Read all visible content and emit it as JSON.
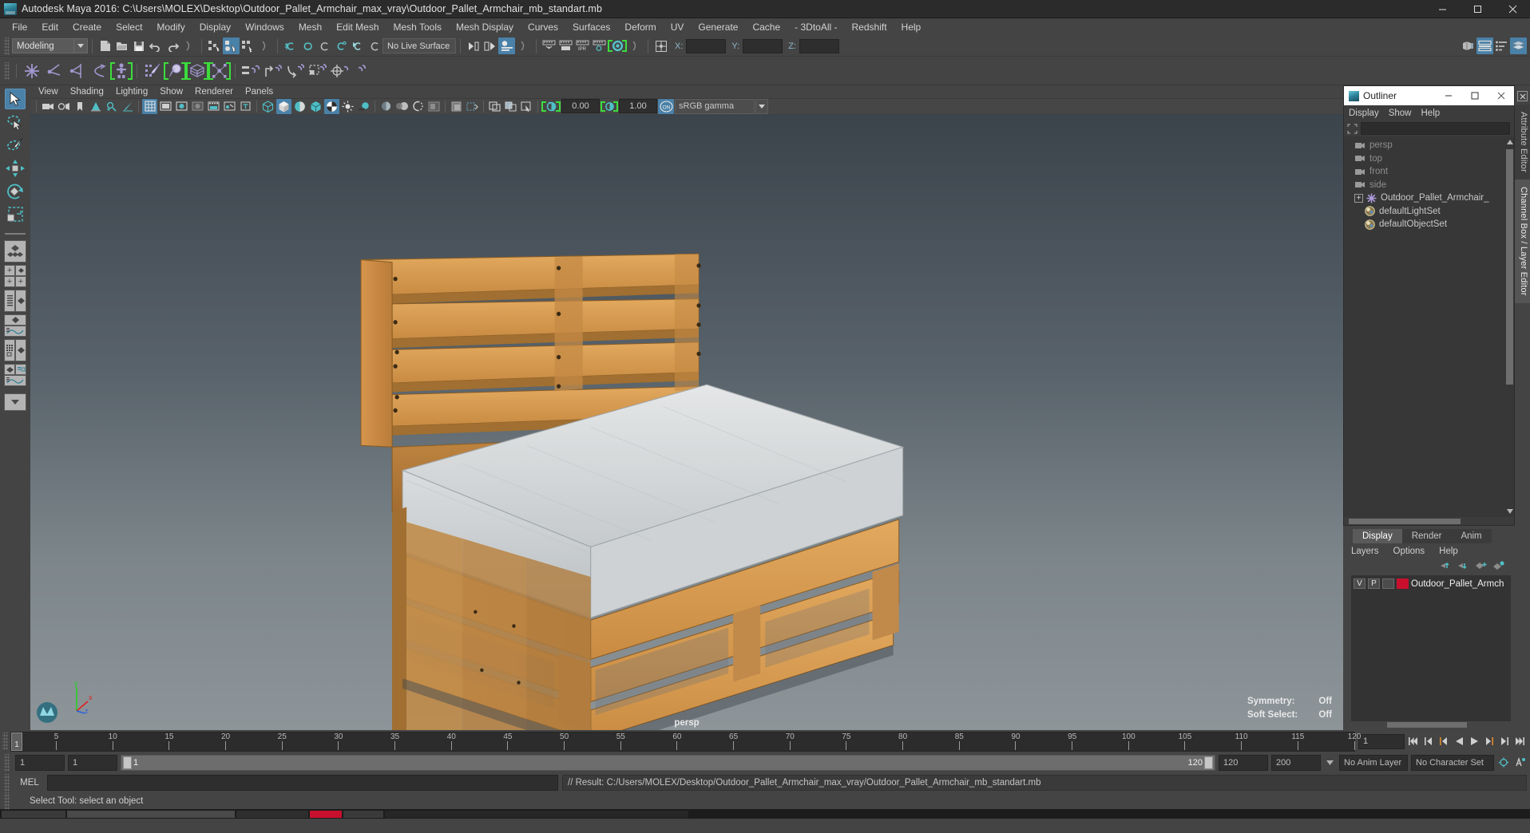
{
  "window": {
    "title": "Autodesk Maya 2016: C:\\Users\\MOLEX\\Desktop\\Outdoor_Pallet_Armchair_max_vray\\Outdoor_Pallet_Armchair_mb_standart.mb",
    "app_icon": "maya-logo-icon",
    "minimize": "minimize-icon",
    "maximize": "maximize-icon",
    "close": "close-icon"
  },
  "menubar": {
    "items": [
      "File",
      "Edit",
      "Create",
      "Select",
      "Modify",
      "Display",
      "Windows",
      "Mesh",
      "Edit Mesh",
      "Mesh Tools",
      "Mesh Display",
      "Curves",
      "Surfaces",
      "Deform",
      "UV",
      "Generate",
      "Cache",
      "- 3DtoAll -",
      "Redshift",
      "Help"
    ]
  },
  "statusline": {
    "mode": "Modeling",
    "live_surface": "No Live Surface",
    "axis_labels": [
      "X:",
      "Y:",
      "Z:"
    ],
    "axis_values": [
      "",
      "",
      ""
    ],
    "icons": [
      "new-scene-icon",
      "open-scene-icon",
      "save-scene-icon",
      "undo-icon",
      "redo-icon",
      "select-hierarchy-icon",
      "select-object-icon",
      "select-component-icon",
      "snap-grid-icon",
      "snap-curve-icon",
      "snap-point-icon",
      "snap-projected-center-icon",
      "snap-view-plane-icon",
      "make-live-icon",
      "render-view-icon",
      "render-current-frame-icon",
      "ipr-render-icon",
      "render-settings-icon",
      "render-globals-icon",
      "input-output-icon"
    ],
    "right_icons": [
      "show-hide-editors-icon",
      "attribute-editor-icon",
      "tool-settings-icon",
      "channel-box-icon"
    ]
  },
  "shelf": {
    "icons": [
      "move-snap-icon",
      "rotate-pivot-icon",
      "scale-axis-icon",
      "mirror-icon",
      "character-icon",
      "paint-weights-icon",
      "sculpt-geometry-icon",
      "lattice-icon",
      "cluster-icon",
      "parent-icon",
      "unparent-icon",
      "group-icon",
      "duplicate-special-icon",
      "constraint-icon",
      "connect-icon"
    ]
  },
  "toolbox": {
    "tools": [
      {
        "name": "select-tool",
        "active": true
      },
      {
        "name": "lasso-select-tool",
        "active": false
      },
      {
        "name": "paint-select-tool",
        "active": false
      },
      {
        "name": "move-tool",
        "active": false
      },
      {
        "name": "rotate-tool",
        "active": false
      },
      {
        "name": "scale-tool",
        "active": false
      }
    ],
    "layouts": [
      "single-perspective-layout",
      "four-view-layout",
      "outliner-persp-layout",
      "persp-graph-layout",
      "hypershade-persp-layout",
      "persp-graph-outliner-layout"
    ]
  },
  "viewport": {
    "menus": [
      "View",
      "Shading",
      "Lighting",
      "Show",
      "Renderer",
      "Panels"
    ],
    "camera_label": "persp",
    "hud": [
      {
        "label": "Symmetry:",
        "value": "Off"
      },
      {
        "label": "Soft Select:",
        "value": "Off"
      }
    ],
    "exposure": "0.00",
    "gamma": "1.00",
    "color_space": "sRGB gamma",
    "color_management_toggle": "ON",
    "axis_gizmo": {
      "x": "x",
      "y": "y",
      "z": "z"
    },
    "icons": [
      "camera-attributes-icon",
      "bookmarks-icon",
      "image-plane-icon",
      "2d-pan-zoom-icon",
      "grease-pencil-icon",
      "grid-icon",
      "film-gate-icon",
      "resolution-gate-icon",
      "gate-mask-icon",
      "exposure-icon",
      "xray-icon",
      "xray-joints-icon",
      "wireframe-icon",
      "smooth-shade-icon",
      "flat-shade-icon",
      "shaded-wireframe-icon",
      "textured-icon",
      "lights-icon",
      "shadows-icon",
      "screen-space-ao-icon",
      "motion-blur-icon",
      "multisample-icon",
      "isolate-select-icon"
    ]
  },
  "outliner": {
    "title": "Outliner",
    "menus": [
      "Display",
      "Show",
      "Help"
    ],
    "search_placeholder": "",
    "search_value": "",
    "rows": [
      {
        "label": "persp",
        "icon": "camera-icon",
        "dim": true,
        "expandable": false
      },
      {
        "label": "top",
        "icon": "camera-icon",
        "dim": true,
        "expandable": false
      },
      {
        "label": "front",
        "icon": "camera-icon",
        "dim": true,
        "expandable": false
      },
      {
        "label": "side",
        "icon": "camera-icon",
        "dim": true,
        "expandable": false
      },
      {
        "label": "Outdoor_Pallet_Armchair_",
        "icon": "transform-group-icon",
        "dim": false,
        "expandable": true
      },
      {
        "label": "defaultLightSet",
        "icon": "set-icon",
        "dim": false,
        "expandable": false
      },
      {
        "label": "defaultObjectSet",
        "icon": "set-icon",
        "dim": false,
        "expandable": false
      }
    ]
  },
  "layer_editor": {
    "tabs": [
      "Display",
      "Render",
      "Anim"
    ],
    "active_tab": "Display",
    "menus": [
      "Layers",
      "Options",
      "Help"
    ],
    "toolbar_icons": [
      "move-layer-up-icon",
      "move-layer-down-icon",
      "new-layer-icon",
      "new-layer-from-selected-icon"
    ],
    "layers": [
      {
        "visibility": "V",
        "playback": "P",
        "type": "",
        "color": "#c8102e",
        "name": "Outdoor_Pallet_Armch"
      }
    ]
  },
  "right_rail": {
    "close": "close-panel-icon",
    "tabs": [
      "Attribute Editor",
      "Channel Box / Layer Editor"
    ],
    "active_tab": "Channel Box / Layer Editor"
  },
  "timeline": {
    "start": 1,
    "end": 120,
    "current_frame": "1",
    "tick_step": 5,
    "ticks": [
      5,
      10,
      15,
      20,
      25,
      30,
      35,
      40,
      45,
      50,
      55,
      60,
      65,
      70,
      75,
      80,
      85,
      90,
      95,
      100,
      105,
      110,
      115,
      120
    ],
    "playback_buttons": [
      "go-to-start-icon",
      "step-back-keyframe-icon",
      "step-back-frame-icon",
      "play-backwards-icon",
      "play-forwards-icon",
      "step-forward-frame-icon",
      "step-forward-keyframe-icon",
      "go-to-end-icon"
    ]
  },
  "range_slider": {
    "anim_start": "1",
    "range_start": "1",
    "bar_start_label": "1",
    "bar_end_label": "120",
    "range_end": "120",
    "anim_end": "200",
    "anim_layer": "No Anim Layer",
    "character_set": "No Character Set",
    "right_icons": [
      "animation-preferences-icon",
      "auto-keyframe-icon"
    ]
  },
  "command_line": {
    "label": "MEL",
    "input_value": "",
    "result": "// Result: C:/Users/MOLEX/Desktop/Outdoor_Pallet_Armchair_max_vray/Outdoor_Pallet_Armchair_mb_standart.mb"
  },
  "help_line": {
    "text": "Select Tool: select an object"
  },
  "colors": {
    "accent_blue": "#4a81a8",
    "bracket_green": "#3ddc3d",
    "shelf_purple": "#a398d0",
    "layer_red": "#c8102e",
    "panel_bg": "#444444",
    "viewport_top": "#3b434b",
    "viewport_bottom": "#8d9599",
    "wood": "#d79a4e",
    "cushion": "#d8dadb"
  }
}
